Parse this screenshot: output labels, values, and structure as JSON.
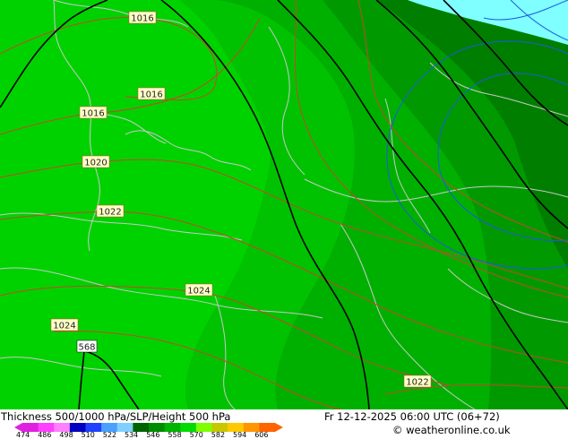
{
  "title": "Thickness 500/1000 hPa/SLP/Height 500 hPa",
  "run_info": "Fr 12-12-2025 06:00 UTC (06+72)",
  "credit": "© weatheronline.co.uk",
  "colorbar": {
    "ticks": [
      "474",
      "486",
      "498",
      "510",
      "522",
      "534",
      "546",
      "558",
      "570",
      "582",
      "594",
      "606"
    ],
    "colors": [
      "#e020e0",
      "#ff40ff",
      "#ff7fff",
      "#0000c0",
      "#2040ff",
      "#4aa0ff",
      "#7fd0ff",
      "#006400",
      "#008c00",
      "#00b400",
      "#00dc00",
      "#7fff00",
      "#c8c800",
      "#ffc800",
      "#ff9600",
      "#ff6400"
    ]
  },
  "pressure_labels": [
    "1016",
    "1016",
    "1016",
    "1020",
    "1022",
    "1024",
    "1024",
    "1022"
  ],
  "height_label": "568",
  "colors": {
    "fill_light": "#00d200",
    "fill_mid": "#00b400",
    "fill_dark": "#008c00",
    "fill_darker": "#006e00",
    "sea_cyan": "#7fffff",
    "isobar": "#c04a2a",
    "height_line": "#000000",
    "thickness_blue": "#1e5adc",
    "coast": "#c8c8c8"
  }
}
